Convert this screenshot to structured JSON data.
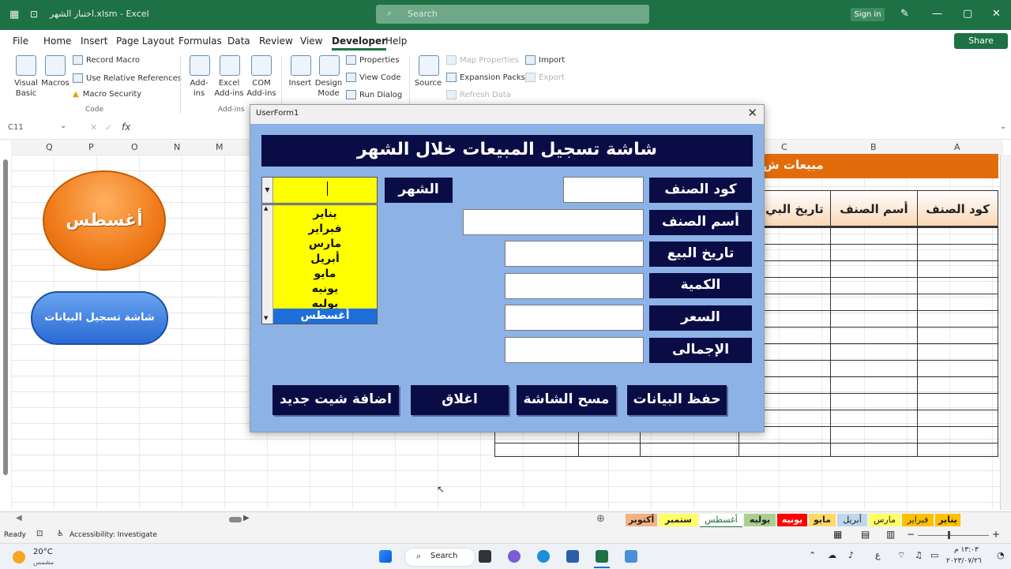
{
  "app": {
    "title": "اختبار الشهر.xlsm  -  Excel",
    "search_placeholder": "Search",
    "signin": "Sign in",
    "share": "Share"
  },
  "menu": [
    "File",
    "Home",
    "Insert",
    "Page Layout",
    "Formulas",
    "Data",
    "Review",
    "View",
    "Developer",
    "Help"
  ],
  "menu_active": "Developer",
  "ribbon": {
    "code": {
      "visual_basic": "Visual Basic",
      "macros": "Macros",
      "record_macro": "Record Macro",
      "use_relative": "Use Relative References",
      "macro_security": "Macro Security",
      "group": "Code"
    },
    "addins": {
      "addins": "Add-ins",
      "excel_addins": "Excel Add-ins",
      "com_addins": "COM Add-ins",
      "group": "Add-ins"
    },
    "controls": {
      "insert": "Insert",
      "design_mode": "Design Mode",
      "properties": "Properties",
      "view_code": "View Code",
      "run_dialog": "Run Dialog"
    },
    "xml": {
      "source": "Source",
      "map_properties": "Map Properties",
      "expansion_packs": "Expansion Packs",
      "refresh_data": "Refresh Data",
      "import": "Import",
      "export": "Export"
    }
  },
  "formula_bar": {
    "name_box": "C11",
    "fx": "fx"
  },
  "columns": [
    "Q",
    "P",
    "O",
    "N",
    "M",
    "C",
    "B",
    "A"
  ],
  "sheet": {
    "banner": "مبيعات ش",
    "headers": [
      "كود الصنف",
      "أسم الصنف",
      "تاريخ البي"
    ]
  },
  "shapes": {
    "oval_text": "أغسطس",
    "register_button": "شاشة تسجيل البيانات"
  },
  "userform": {
    "title": "UserForm1",
    "header": "شاشة تسجيل المبيعات خلال الشهر",
    "fields": [
      {
        "label": "كود الصنف",
        "value": ""
      },
      {
        "label": "أسم الصنف",
        "value": ""
      },
      {
        "label": "تاريخ البيع",
        "value": ""
      },
      {
        "label": "الكمية",
        "value": ""
      },
      {
        "label": "السعر",
        "value": ""
      },
      {
        "label": "الإجمالى",
        "value": ""
      }
    ],
    "month_label": "الشهر",
    "months": [
      "يناير",
      "فبراير",
      "مارس",
      "أبريل",
      "مايو",
      "يونيه",
      "يوليه",
      "أغسطس"
    ],
    "selected_month": "أغسطس",
    "buttons": {
      "save": "حفظ البيانات",
      "clear": "مسح الشاشة",
      "close": "اغلاق",
      "add_sheet": "اضافة شيت جديد"
    }
  },
  "sheet_tabs": [
    {
      "label": "يناير",
      "color": "#ffc000"
    },
    {
      "label": "فبراير",
      "color": "#ffc000"
    },
    {
      "label": "مارس",
      "color": "#ffff66"
    },
    {
      "label": "أبريل",
      "color": "#bdd7ee"
    },
    {
      "label": "مايو",
      "color": "#ffd966"
    },
    {
      "label": "يونيه",
      "color": "#ff0000"
    },
    {
      "label": "يوليه",
      "color": "#a9d08e"
    },
    {
      "label": "أغسطس",
      "color": "#ffffff"
    },
    {
      "label": "ستمبر",
      "color": "#ffff66"
    },
    {
      "label": "أكتوبر",
      "color": "#f4b183"
    }
  ],
  "active_tab": "أغسطس",
  "status": {
    "ready": "Ready",
    "accessibility": "Accessibility: Investigate"
  },
  "taskbar": {
    "weather_temp": "20°C",
    "weather_desc": "مشمس",
    "search": "Search",
    "lang": "ع",
    "time": "١٣:٠٣ م",
    "date": "٢٠٢٣/٠٧/٢٦"
  }
}
